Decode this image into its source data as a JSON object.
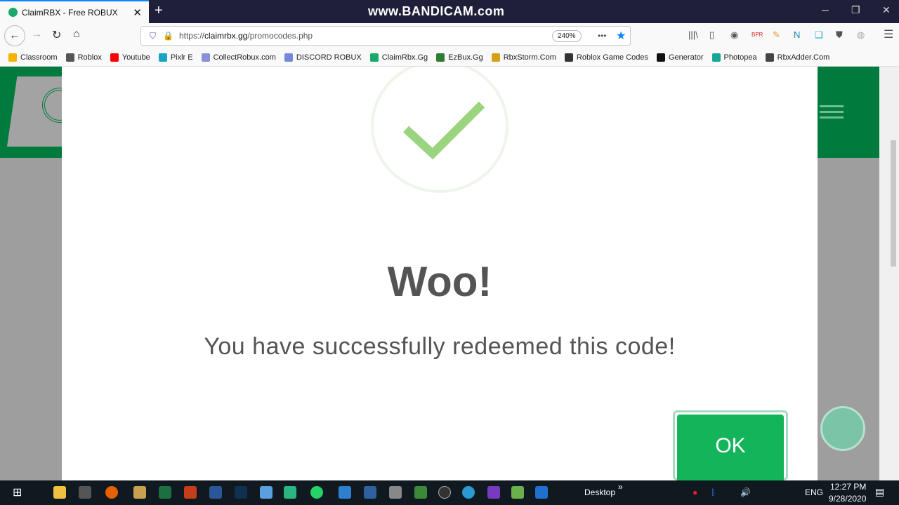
{
  "browser": {
    "tab_title": "ClaimRBX - Free ROBUX",
    "new_tab": "+",
    "watermark": "www.BANDICAM.com",
    "url_prefix": "https://",
    "url_host": "claimrbx.gg",
    "url_path": "/promocodes.php",
    "zoom_level": "240%",
    "bookmarks": [
      {
        "label": "Classroom",
        "color": "#f4b400"
      },
      {
        "label": "Roblox",
        "color": "#555555"
      },
      {
        "label": "Youtube",
        "color": "#ff0000"
      },
      {
        "label": "Pixlr E",
        "color": "#1aa3c4"
      },
      {
        "label": "CollectRobux.com",
        "color": "#8a8fd6"
      },
      {
        "label": "DISCORD ROBUX",
        "color": "#7289da"
      },
      {
        "label": "ClaimRbx.Gg",
        "color": "#1aa86b"
      },
      {
        "label": "EzBux.Gg",
        "color": "#2e7d32"
      },
      {
        "label": "RbxStorm.Com",
        "color": "#d4a017"
      },
      {
        "label": "Roblox Game Codes",
        "color": "#333333"
      },
      {
        "label": "Generator",
        "color": "#111111"
      },
      {
        "label": "Photopea",
        "color": "#18a497"
      },
      {
        "label": "RbxAdder.Com",
        "color": "#444444"
      }
    ]
  },
  "modal": {
    "title": "Woo!",
    "message": "You have successfully redeemed this code!",
    "ok_label": "OK",
    "accent": "#14b45a"
  },
  "taskbar": {
    "desktop_label": "Desktop",
    "language": "ENG",
    "time": "12:27 PM",
    "date": "9/28/2020"
  }
}
